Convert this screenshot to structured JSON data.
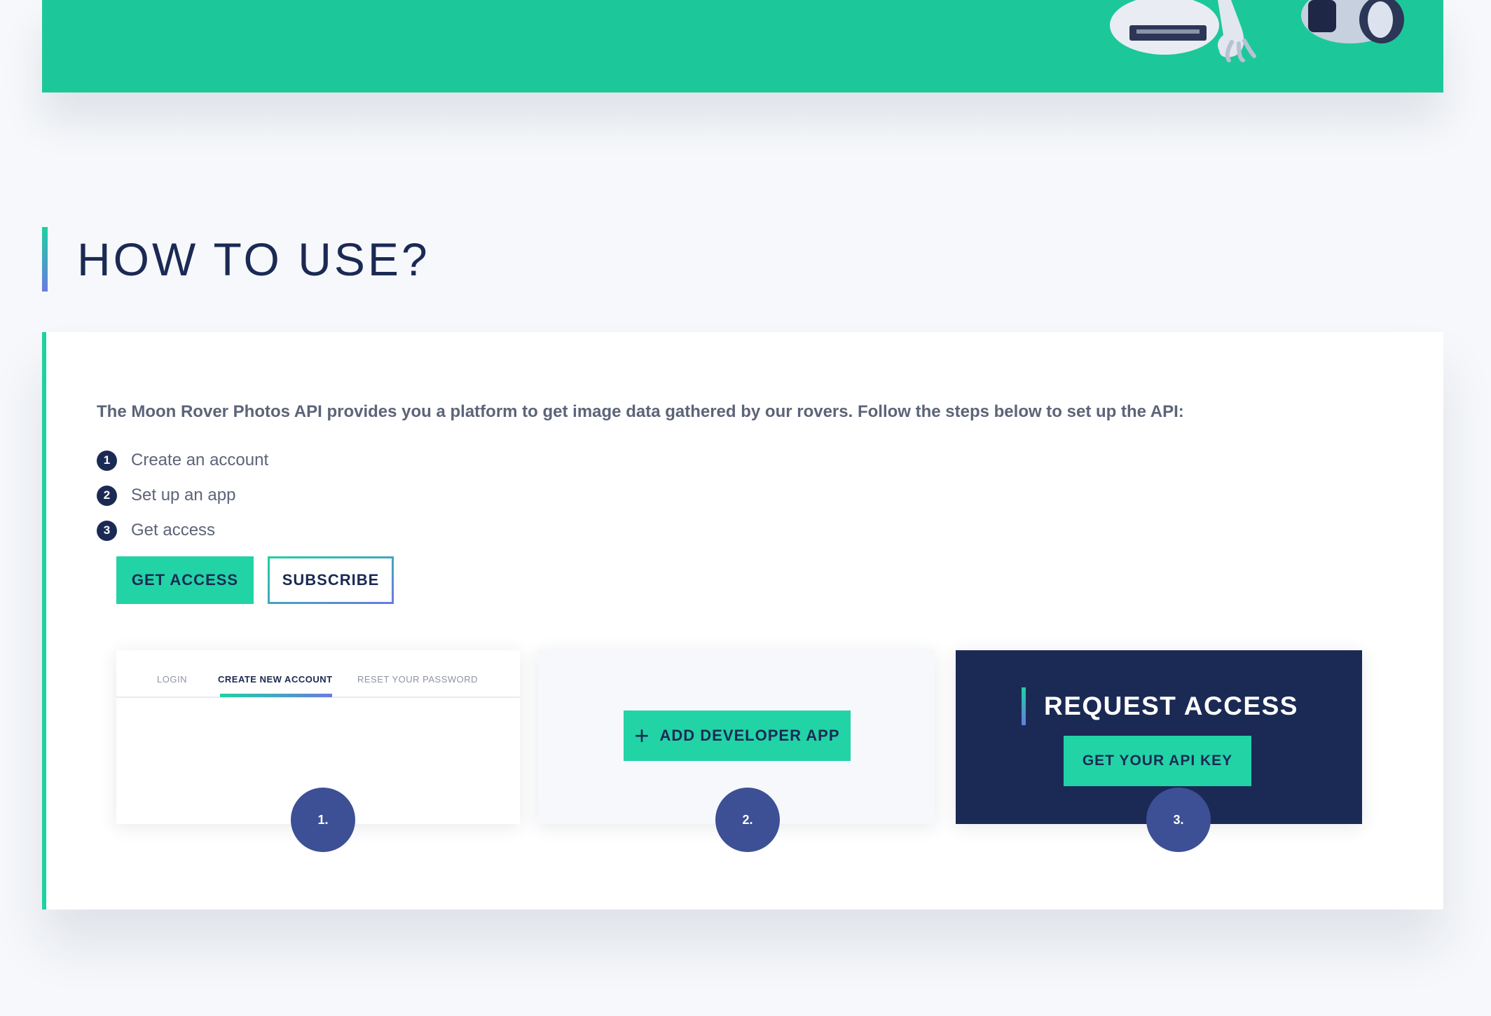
{
  "section": {
    "title": "HOW TO USE?"
  },
  "card": {
    "intro": "The Moon Rover Photos API provides you a platform to get image data gathered by our rovers. Follow the steps below to set up the API:",
    "steps": [
      {
        "number": "1",
        "label": "Create an account"
      },
      {
        "number": "2",
        "label": "Set up an app"
      },
      {
        "number": "3",
        "label": "Get access"
      }
    ],
    "buttons": {
      "get_access": "GET ACCESS",
      "subscribe": "SUBSCRIBE"
    }
  },
  "panels": {
    "account": {
      "tabs": [
        "LOGIN",
        "CREATE NEW ACCOUNT",
        "RESET YOUR PASSWORD"
      ],
      "active_tab": "CREATE NEW ACCOUNT",
      "badge": "1."
    },
    "app": {
      "button_label": "ADD DEVELOPER APP",
      "icon": "plus-icon",
      "badge": "2."
    },
    "access": {
      "title": "REQUEST ACCESS",
      "button_label": "GET YOUR API KEY",
      "badge": "3."
    }
  },
  "colors": {
    "accent": "#1dd1a1",
    "accent_secondary": "#6a7ae0",
    "navy": "#1b2a54",
    "badge": "#3d5095",
    "background": "#f6f8fb"
  }
}
